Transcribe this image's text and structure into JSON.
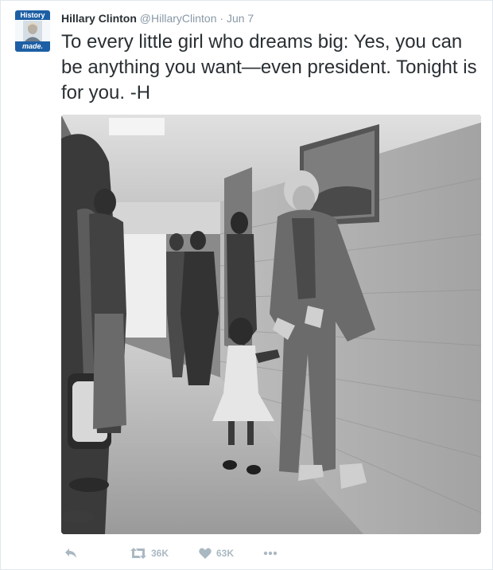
{
  "tweet": {
    "avatar_text_top": "History",
    "avatar_text_bottom": "made.",
    "author_name": "Hillary Clinton",
    "author_handle": "@HillaryClinton",
    "separator": "·",
    "timestamp": "Jun 7",
    "text": "To every little girl who dreams big: Yes, you can be anything you want—even president. Tonight is for you. -H"
  },
  "actions": {
    "reply_icon": "reply-icon",
    "retweet_icon": "retweet-icon",
    "retweet_count": "36K",
    "like_icon": "heart-icon",
    "like_count": "63K",
    "more_icon": "more-icon"
  },
  "colors": {
    "text": "#292f33",
    "secondary": "#8899a6",
    "action": "#aab8c2",
    "avatar_banner": "#1d5fa5"
  }
}
